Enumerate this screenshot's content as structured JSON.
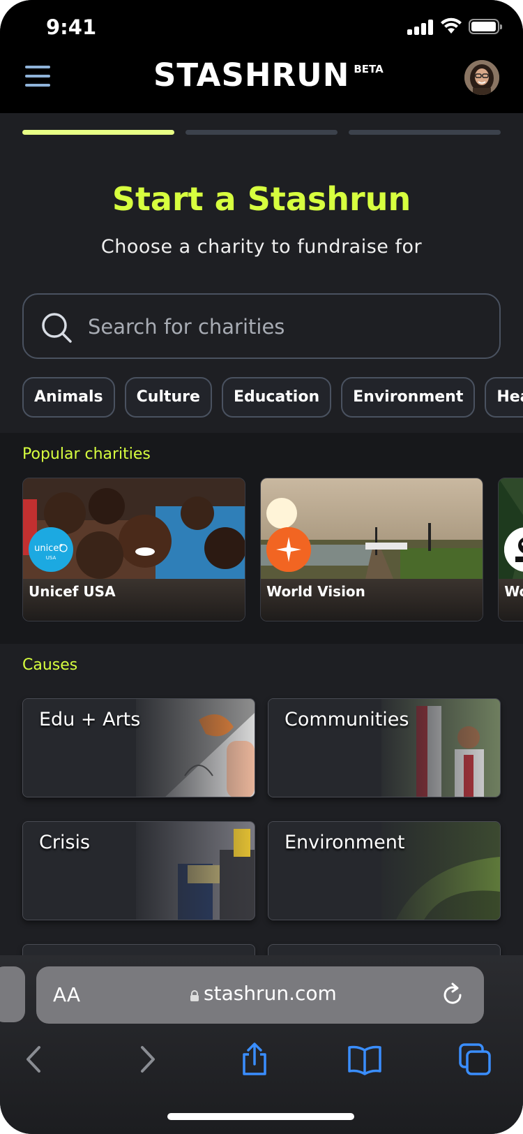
{
  "status_bar": {
    "time": "9:41"
  },
  "header": {
    "logo": "STASHRUN",
    "logo_badge": "BETA"
  },
  "page": {
    "title": "Start a Stashrun",
    "subtitle": "Choose a charity to fundraise for"
  },
  "progress": {
    "steps_total": 3,
    "current_step": 1,
    "active_color": "#e8ff86",
    "inactive_color": "#3c424c"
  },
  "search": {
    "placeholder": "Search for charities",
    "value": ""
  },
  "categories": [
    "Animals",
    "Culture",
    "Education",
    "Environment",
    "Healt"
  ],
  "popular": {
    "label": "Popular charities",
    "charities": [
      {
        "name": "Unicef USA",
        "logo_text": "unicef",
        "logo_sub": "USA"
      },
      {
        "name": "World Vision"
      },
      {
        "name": "Wor"
      }
    ]
  },
  "causes": {
    "label": "Causes",
    "items": [
      {
        "title": "Edu + Arts"
      },
      {
        "title": "Communities"
      },
      {
        "title": "Crisis"
      },
      {
        "title": "Environment"
      }
    ]
  },
  "browser": {
    "text_size_label": "AA",
    "url": "stashrun.com"
  },
  "colors": {
    "accent": "#d7ff3f",
    "background": "#1e1f23",
    "ios_blue": "#3a8eff"
  }
}
